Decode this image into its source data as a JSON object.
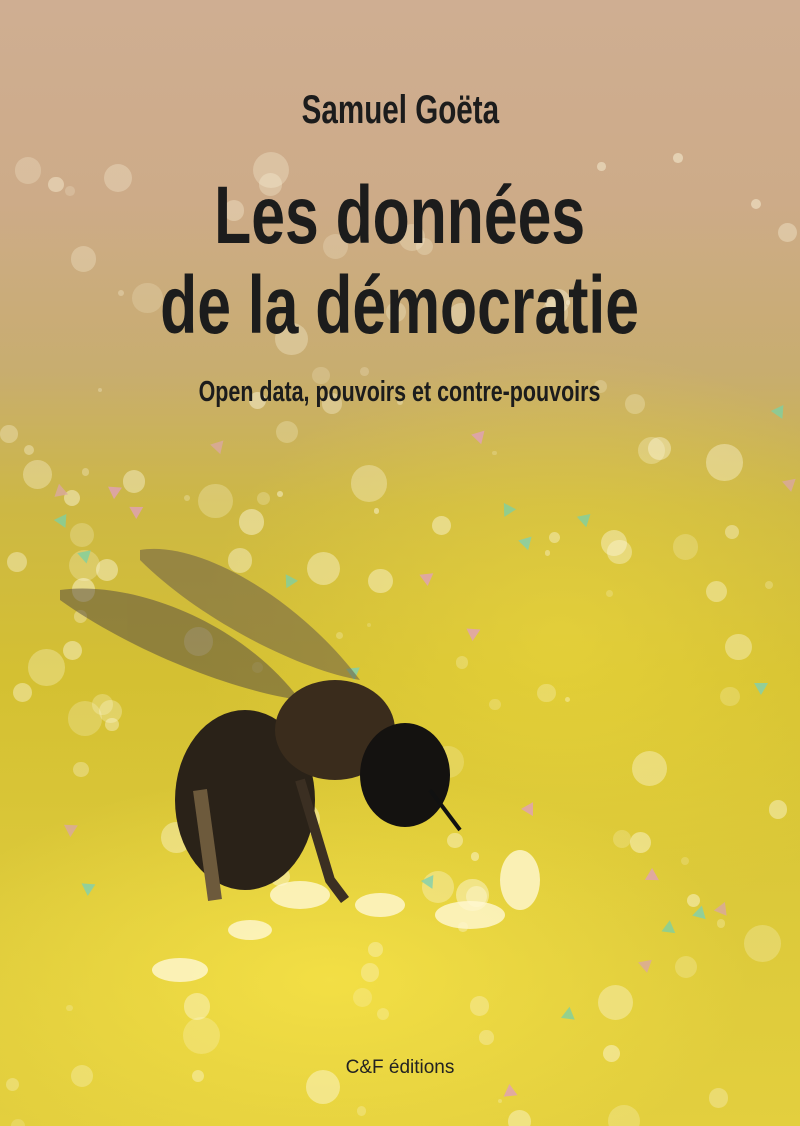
{
  "cover": {
    "author": "Samuel Goëta",
    "title_line1": "Les données",
    "title_line2": "de la démocratie",
    "subtitle": "Open data, pouvoirs et contre-pouvoirs",
    "publisher": "C&F éditions"
  },
  "colors": {
    "text": "#1c1c1c",
    "top_bg": "#cfae92",
    "bottom_bg": "#e3cf3e"
  }
}
